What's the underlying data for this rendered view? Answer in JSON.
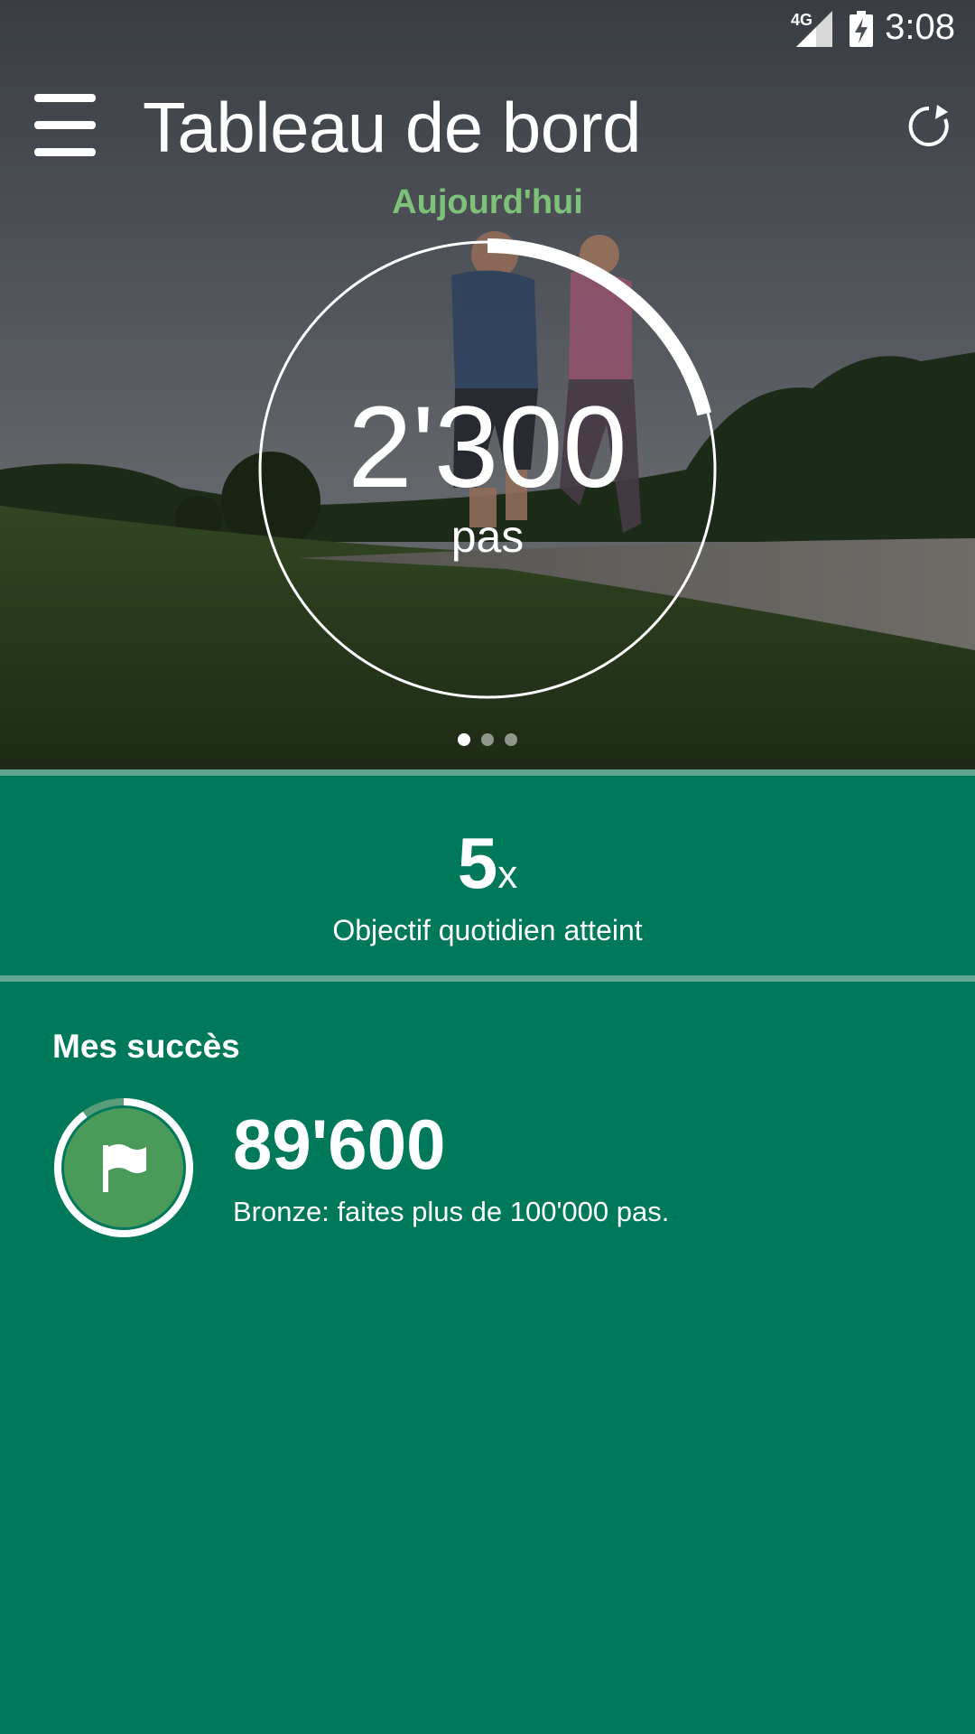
{
  "status_bar": {
    "network": "4G",
    "time": "3:08"
  },
  "toolbar": {
    "title": "Tableau de bord",
    "menu_icon": "hamburger-menu-icon",
    "refresh_icon": "refresh-icon"
  },
  "steps": {
    "period": "Aujourd'hui",
    "value": "2'300",
    "unit": "pas",
    "goal_progress_fraction": 0.21
  },
  "pager": {
    "pages": 3,
    "active_page": 1
  },
  "daily_goal": {
    "count": "5",
    "suffix": "x",
    "label": "Objectif quotidien atteint"
  },
  "achievements": {
    "heading": "Mes succès",
    "items": [
      {
        "icon": "flag-icon",
        "value": "89'600",
        "description": "Bronze: faites plus de 100'000 pas.",
        "progress_fraction": 0.9
      }
    ]
  },
  "colors": {
    "panel_green": "#00785a",
    "divider": "#5fa592",
    "accent_green": "#7dc278",
    "badge_green": "#4a9a5a"
  }
}
